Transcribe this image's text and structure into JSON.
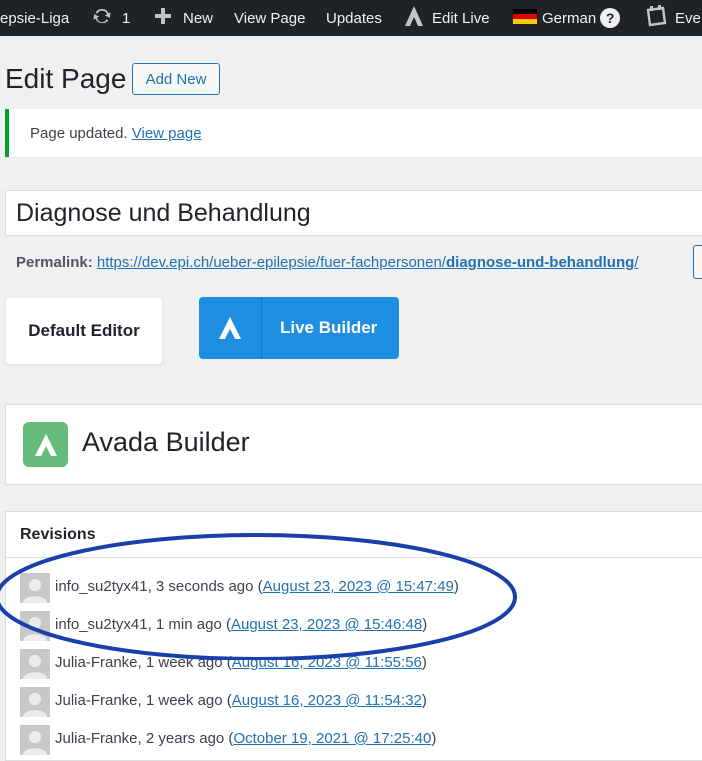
{
  "adminbar": {
    "site_name": "epsie-Liga",
    "updates_count": "1",
    "new_label": "New",
    "view_page_label": "View Page",
    "updates_label": "Updates",
    "edit_live_label": "Edit Live",
    "language_label": "German",
    "help_icon": "?",
    "events_label": "Eve"
  },
  "header": {
    "title": "Edit Page",
    "add_new_label": "Add New"
  },
  "notice": {
    "text": "Page updated.",
    "link_label": "View page",
    "color": "#00a32a"
  },
  "editor": {
    "title_value": "Diagnose und Behandlung",
    "permalink_label": "Permalink:",
    "permalink_base": "https://dev.epi.ch/ueber-epilepsie/fuer-fachpersonen/",
    "permalink_slug": "diagnose-und-behandlung",
    "permalink_trailing": "/",
    "default_editor_label": "Default Editor",
    "live_builder_label": "Live Builder",
    "accent_color": "#1e8fe0"
  },
  "avada": {
    "title": "Avada Builder",
    "logo_color": "#65bc7b"
  },
  "revisions": {
    "title": "Revisions",
    "items": [
      {
        "author": "info_su2tyx41",
        "ago": "3 seconds ago",
        "date": "August 23, 2023 @ 15:47:49"
      },
      {
        "author": "info_su2tyx41",
        "ago": "1 min ago",
        "date": "August 23, 2023 @ 15:46:48"
      },
      {
        "author": "Julia-Franke",
        "ago": "1 week ago",
        "date": "August 16, 2023 @ 11:55:56"
      },
      {
        "author": "Julia-Franke",
        "ago": "1 week ago",
        "date": "August 16, 2023 @ 11:54:32"
      },
      {
        "author": "Julia-Franke",
        "ago": "2 years ago",
        "date": "October 19, 2021 @ 17:25:40"
      }
    ]
  },
  "annotation_color": "#1a3faa"
}
